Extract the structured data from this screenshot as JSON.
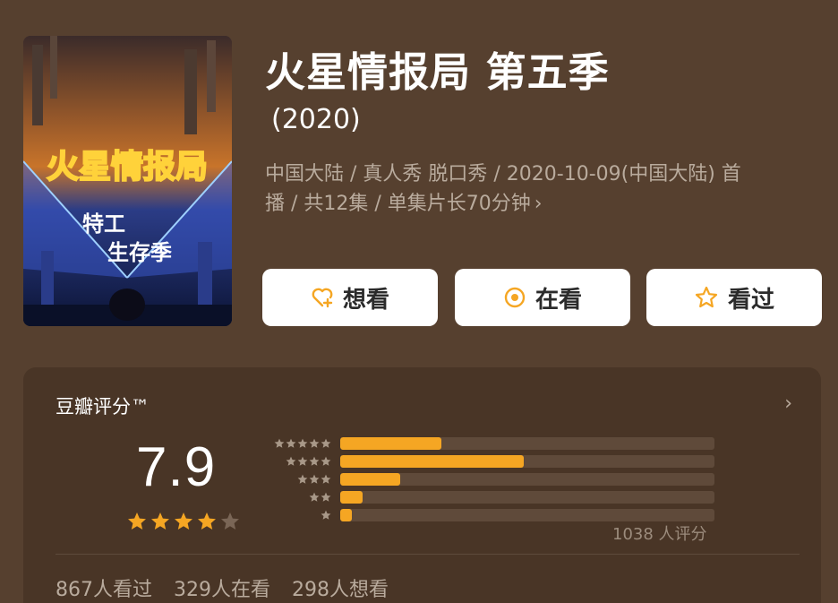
{
  "poster": {
    "logo_text": "火星情报局",
    "subtitle_line1": "特工",
    "subtitle_line2": "生存季"
  },
  "header": {
    "title": "火星情报局 第五季",
    "year": "(2020)",
    "meta_line1": "中国大陆 / 真人秀 脱口秀 / 2020-10-09(中国大陆) 首",
    "meta_line2": "播 / 共12集 / 单集片长70分钟",
    "meta_chevron": "›"
  },
  "actions": {
    "want_label": "想看",
    "doing_label": "在看",
    "done_label": "看过"
  },
  "rating": {
    "title": "豆瓣评分™",
    "score": "7.9",
    "score_stars": 4,
    "distribution": [
      {
        "stars": 5,
        "fraction": 0.27
      },
      {
        "stars": 4,
        "fraction": 0.49
      },
      {
        "stars": 3,
        "fraction": 0.16
      },
      {
        "stars": 2,
        "fraction": 0.06
      },
      {
        "stars": 1,
        "fraction": 0.03
      }
    ],
    "count_text": "1038 人评分",
    "chevron": "›"
  },
  "stats": {
    "watched": "867人看过",
    "watching": "329人在看",
    "want": "298人想看"
  },
  "colors": {
    "background": "#56402f",
    "card": "#493526",
    "accent": "#f5a623",
    "muted_text": "#b9ab9d"
  }
}
